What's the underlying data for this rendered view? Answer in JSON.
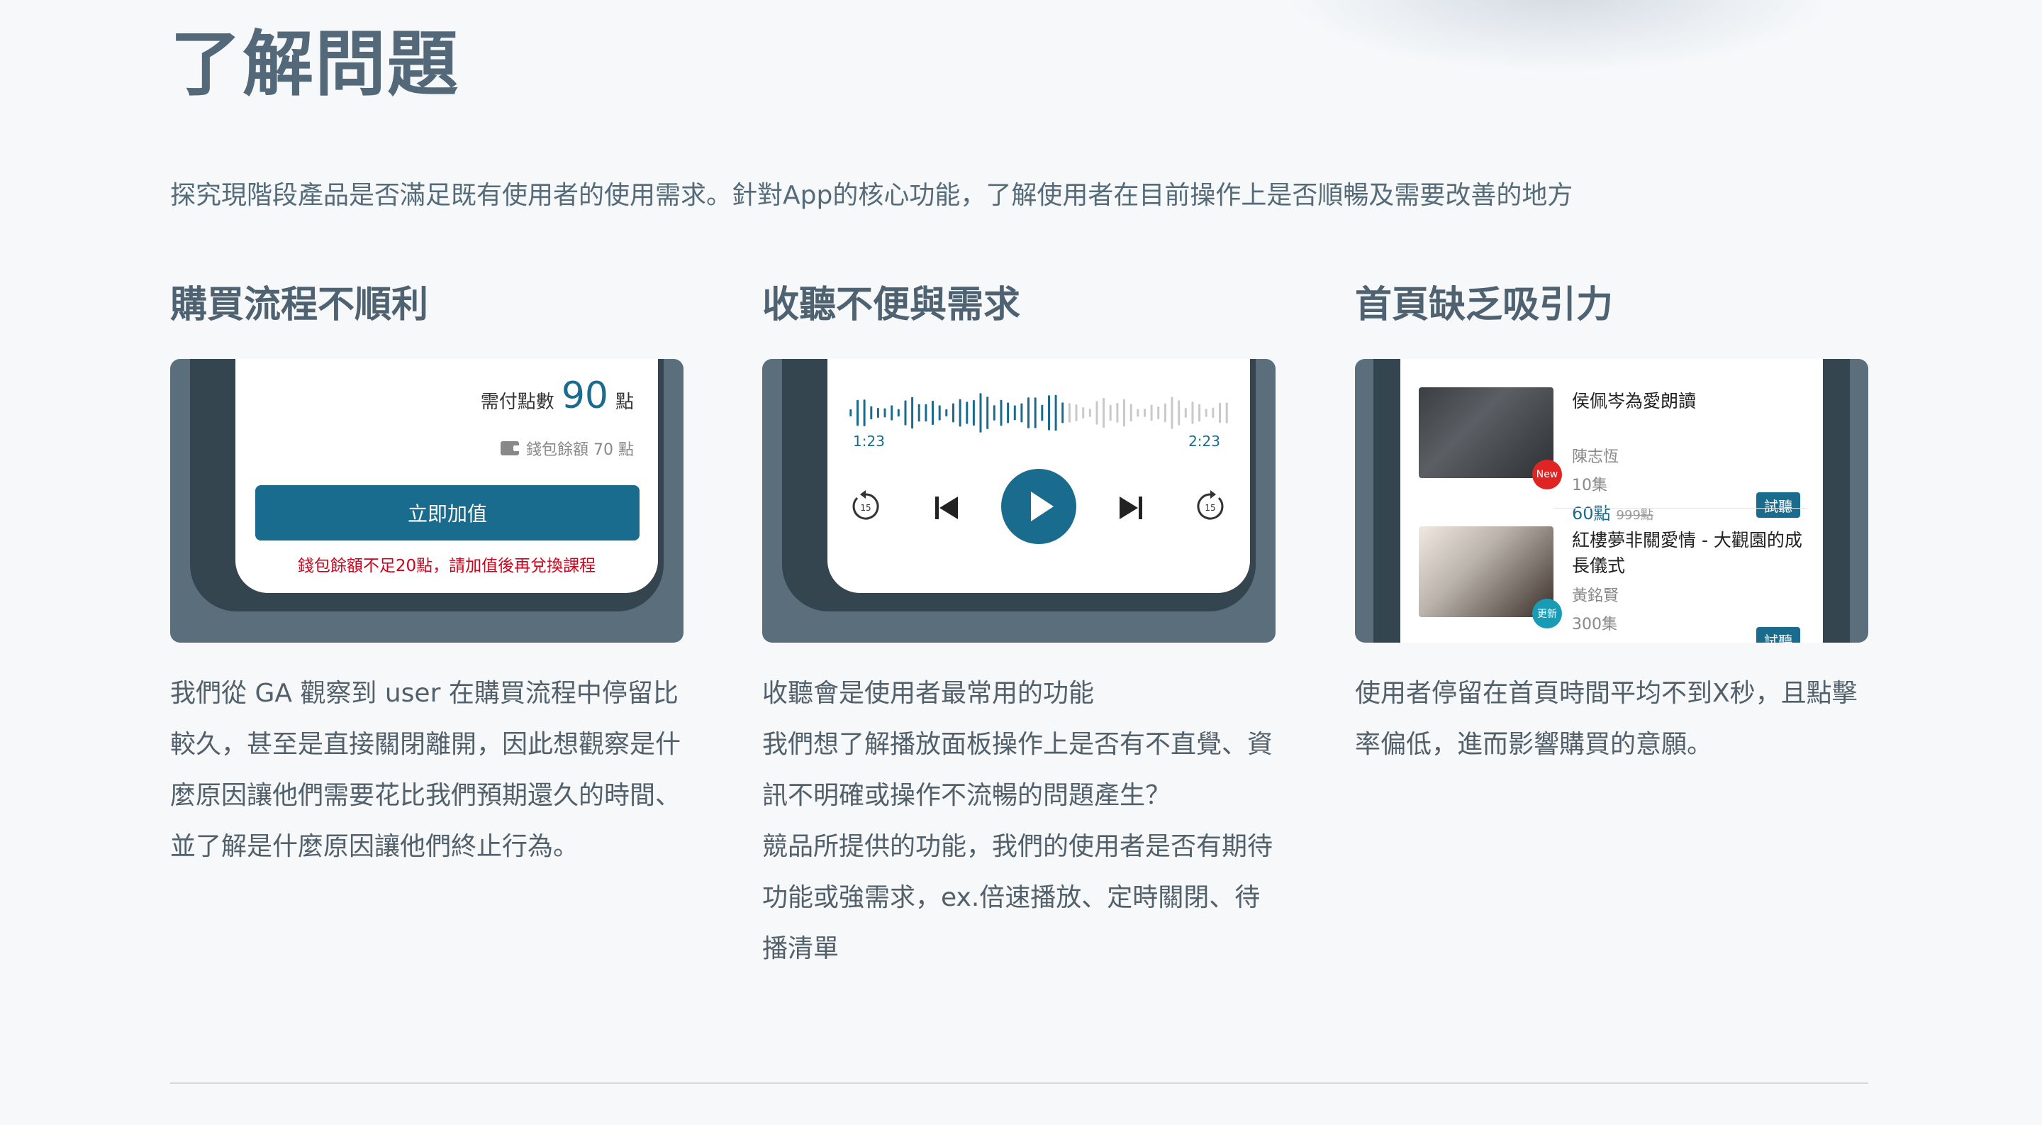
{
  "page": {
    "title": "了解問題",
    "intro": "探究現階段產品是否滿足既有使用者的使用需求。針對App的核心功能，了解使用者在目前操作上是否順暢及需要改善的地方"
  },
  "columns": [
    {
      "heading": "購買流程不順利",
      "description": "我們從 GA 觀察到 user 在購買流程中停留比較久，甚至是直接關閉離開，因此想觀察是什麼原因讓他們需要花比我們預期還久的時間、並了解是什麼原因讓他們終止行為。",
      "card": {
        "pay_label": "需付點數",
        "pay_value": "90",
        "pay_unit": "點",
        "wallet_text": "錢包餘額 70 點",
        "topup_button": "立即加值",
        "warning": "錢包餘額不足20點，請加值後再兌換課程"
      }
    },
    {
      "heading": "收聽不便與需求",
      "description_lines": [
        "收聽會是使用者最常用的功能",
        "我們想了解播放面板操作上是否有不直覺、資訊不明確或操作不流暢的問題產生？",
        "競品所提供的功能，我們的使用者是否有期待功能或強需求，ex.倍速播放、定時關閉、待播清單"
      ],
      "card": {
        "time_start": "1:23",
        "time_end": "2:23",
        "skip_seconds": "15",
        "progress": 0.58
      }
    },
    {
      "heading": "首頁缺乏吸引力",
      "description": "使用者停留在首頁時間平均不到X秒，且點擊率偏低，進而影響購買的意願。",
      "card": {
        "courses": [
          {
            "title": "侯佩岑為愛朗讀",
            "author": "陳志恆",
            "episodes": "10集",
            "price": "60點",
            "old_price": "999點",
            "badge": "New",
            "try_label": "試聽"
          },
          {
            "title": "紅樓夢非關愛情 - 大觀園的成長儀式",
            "author": "黃銘賢",
            "episodes": "300集",
            "badge": "更新",
            "try_label": "試聽"
          }
        ]
      }
    }
  ],
  "colors": {
    "accent": "#1a6c8f",
    "warning": "#d0021b",
    "card_bg": "#5a6e7c",
    "frame": "#344550",
    "heading": "#4f6271"
  }
}
